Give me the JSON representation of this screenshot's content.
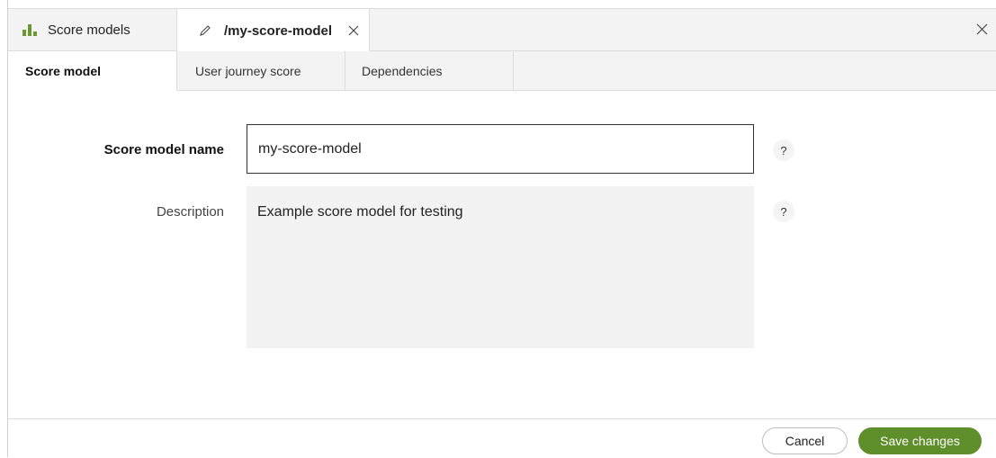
{
  "tabs": {
    "list_label": "Score models",
    "edit_label": "/my-score-model"
  },
  "subtabs": [
    {
      "label": "Score model"
    },
    {
      "label": "User journey score"
    },
    {
      "label": "Dependencies"
    }
  ],
  "form": {
    "name_label": "Score model name",
    "name_value": "my-score-model",
    "description_label": "Description",
    "description_value": "Example score model for testing",
    "help_symbol": "?"
  },
  "footer": {
    "cancel_label": "Cancel",
    "save_label": "Save changes"
  },
  "colors": {
    "accent": "#5f8f2a",
    "tab_bg": "#f3f3f3"
  },
  "icons": [
    "bar-chart-icon",
    "pencil-icon",
    "close-icon",
    "window-close-icon"
  ]
}
